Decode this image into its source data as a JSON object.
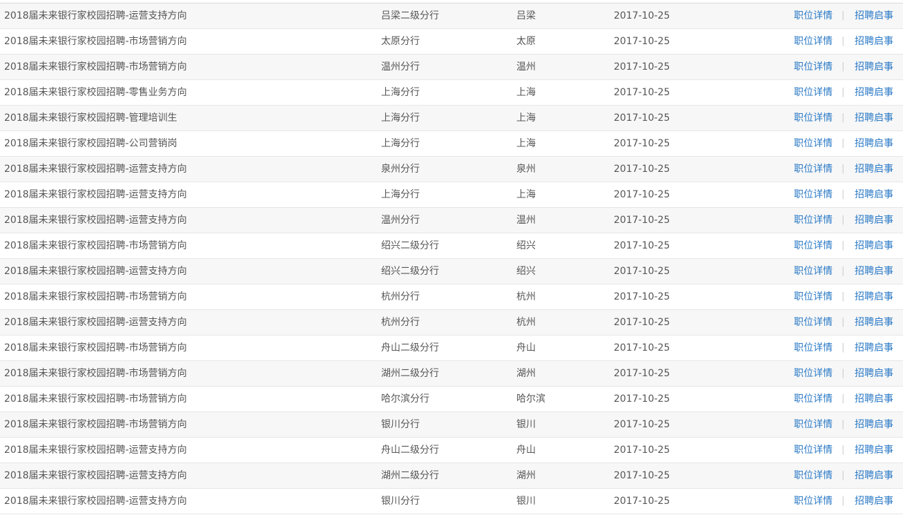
{
  "actions": {
    "detail_label": "职位详情",
    "separator": "|",
    "notice_label": "招聘启事"
  },
  "colors": {
    "link": "#2a79c6",
    "text": "#555555",
    "row_alt": "#f7f7f7"
  },
  "rows": [
    {
      "title": "2018届未来银行家校园招聘-运营支持方向",
      "branch": "吕梁二级分行",
      "city": "吕梁",
      "date": "2017-10-25"
    },
    {
      "title": "2018届未来银行家校园招聘-市场营销方向",
      "branch": "太原分行",
      "city": "太原",
      "date": "2017-10-25"
    },
    {
      "title": "2018届未来银行家校园招聘-市场营销方向",
      "branch": "温州分行",
      "city": "温州",
      "date": "2017-10-25"
    },
    {
      "title": "2018届未来银行家校园招聘-零售业务方向",
      "branch": "上海分行",
      "city": "上海",
      "date": "2017-10-25"
    },
    {
      "title": "2018届未来银行家校园招聘-管理培训生",
      "branch": "上海分行",
      "city": "上海",
      "date": "2017-10-25"
    },
    {
      "title": "2018届未来银行家校园招聘-公司营销岗",
      "branch": "上海分行",
      "city": "上海",
      "date": "2017-10-25"
    },
    {
      "title": "2018届未来银行家校园招聘-运营支持方向",
      "branch": "泉州分行",
      "city": "泉州",
      "date": "2017-10-25"
    },
    {
      "title": "2018届未来银行家校园招聘-运营支持方向",
      "branch": "上海分行",
      "city": "上海",
      "date": "2017-10-25"
    },
    {
      "title": "2018届未来银行家校园招聘-运营支持方向",
      "branch": "温州分行",
      "city": "温州",
      "date": "2017-10-25"
    },
    {
      "title": "2018届未来银行家校园招聘-市场营销方向",
      "branch": "绍兴二级分行",
      "city": "绍兴",
      "date": "2017-10-25"
    },
    {
      "title": "2018届未来银行家校园招聘-运营支持方向",
      "branch": "绍兴二级分行",
      "city": "绍兴",
      "date": "2017-10-25"
    },
    {
      "title": "2018届未来银行家校园招聘-市场营销方向",
      "branch": "杭州分行",
      "city": "杭州",
      "date": "2017-10-25"
    },
    {
      "title": "2018届未来银行家校园招聘-运营支持方向",
      "branch": "杭州分行",
      "city": "杭州",
      "date": "2017-10-25"
    },
    {
      "title": "2018届未来银行家校园招聘-市场营销方向",
      "branch": "舟山二级分行",
      "city": "舟山",
      "date": "2017-10-25"
    },
    {
      "title": "2018届未来银行家校园招聘-市场营销方向",
      "branch": "湖州二级分行",
      "city": "湖州",
      "date": "2017-10-25"
    },
    {
      "title": "2018届未来银行家校园招聘-市场营销方向",
      "branch": "哈尔滨分行",
      "city": "哈尔滨",
      "date": "2017-10-25"
    },
    {
      "title": "2018届未来银行家校园招聘-市场营销方向",
      "branch": "银川分行",
      "city": "银川",
      "date": "2017-10-25"
    },
    {
      "title": "2018届未来银行家校园招聘-运营支持方向",
      "branch": "舟山二级分行",
      "city": "舟山",
      "date": "2017-10-25"
    },
    {
      "title": "2018届未来银行家校园招聘-运营支持方向",
      "branch": "湖州二级分行",
      "city": "湖州",
      "date": "2017-10-25"
    },
    {
      "title": "2018届未来银行家校园招聘-运营支持方向",
      "branch": "银川分行",
      "city": "银川",
      "date": "2017-10-25"
    }
  ]
}
